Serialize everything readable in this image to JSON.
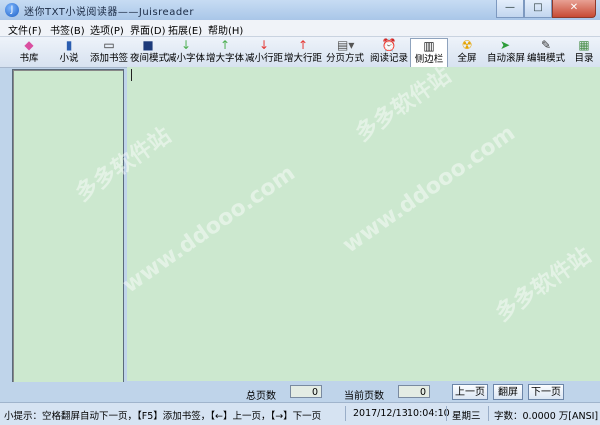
{
  "window": {
    "title": "迷你TXT小说阅读器——Juisreader",
    "controls": {
      "minimize": "—",
      "maximize": "□",
      "close": "✕"
    }
  },
  "menu": {
    "items": [
      "文件(F)",
      "书签(B)",
      "选项(P)",
      "界面(D)",
      "拓展(E)",
      "帮助(H)"
    ]
  },
  "toolbar": {
    "items": [
      {
        "label": "书库",
        "icon": "bookshelf-icon"
      },
      {
        "label": "小说",
        "icon": "book-icon"
      },
      {
        "label": "添加书签",
        "icon": "bookmark-icon"
      },
      {
        "label": "夜间模式",
        "icon": "night-mode-icon"
      },
      {
        "label": "减小字体",
        "icon": "font-decrease-icon"
      },
      {
        "label": "增大字体",
        "icon": "font-increase-icon"
      },
      {
        "label": "减小行距",
        "icon": "line-spacing-decrease-icon"
      },
      {
        "label": "增大行距",
        "icon": "line-spacing-increase-icon"
      },
      {
        "label": "分页方式",
        "icon": "pagination-icon"
      },
      {
        "label": "阅读记录",
        "icon": "clock-icon"
      },
      {
        "label": "侧边栏",
        "icon": "sidebar-icon"
      },
      {
        "label": "全屏",
        "icon": "fullscreen-icon"
      },
      {
        "label": "自动滚屏",
        "icon": "auto-scroll-icon"
      },
      {
        "label": "编辑模式",
        "icon": "edit-icon"
      },
      {
        "label": "目录",
        "icon": "table-of-contents-icon"
      }
    ]
  },
  "pager": {
    "total_pages_label": "总页数",
    "total_pages_value": "0",
    "current_page_label": "当前页数",
    "current_page_value": "0",
    "prev_button": "上一页",
    "flip_button": "翻屏",
    "next_button": "下一页"
  },
  "status": {
    "tip": "小提示：空格翻屏自动下一页，【F5】添加书签，【←】上一页，【→】下一页",
    "date": "2017/12/13",
    "time": "10:04:10",
    "weekday": "星期三",
    "word_count": "字数：0.0000 万[ANSI]"
  },
  "watermark": {
    "text1": "多多软件站",
    "text2": "www.ddooo.com"
  },
  "colors": {
    "reading_bg": "#cce8cf",
    "chrome": "#bfd4ea"
  }
}
